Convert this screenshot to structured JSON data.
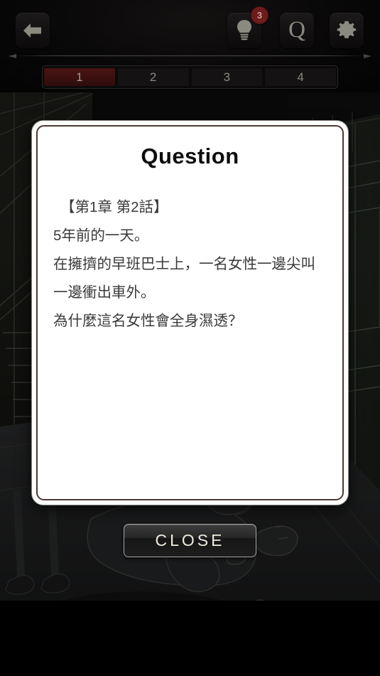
{
  "topbar": {
    "back_label": "back",
    "hint_icon": "lightbulb-icon",
    "hint_badge_count": "3",
    "question_label": "Q",
    "settings_icon": "gear-icon"
  },
  "tabs": [
    {
      "label": "1",
      "active": true
    },
    {
      "label": "2",
      "active": false
    },
    {
      "label": "3",
      "active": false
    },
    {
      "label": "4",
      "active": false
    }
  ],
  "dialog": {
    "title": "Question",
    "lines": [
      "【第1章 第2話】",
      "5年前的一天。",
      "在擁擠的早班巴士上，一名女性一邊尖叫",
      "一邊衝出車外。",
      "為什麼這名女性會全身濕透？"
    ]
  },
  "close_button": {
    "label": "CLOSE"
  },
  "colors": {
    "accent_red": "#6d1c1c",
    "tab_active": "#3a0f0f",
    "dialog_border": "#4a3a33",
    "dialog_bg": "#ffffff",
    "body_text": "#3a3a3a",
    "icon": "#8b8a80",
    "close_text": "#efeade"
  }
}
